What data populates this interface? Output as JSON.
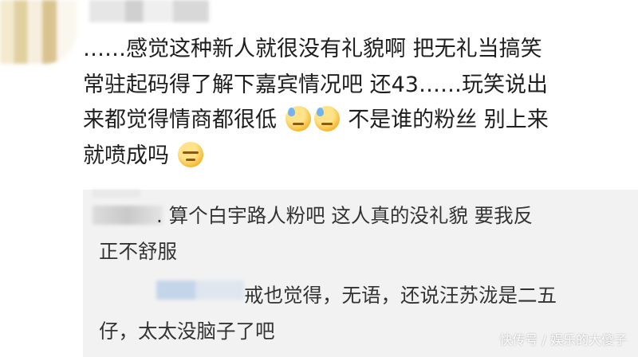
{
  "comment": {
    "line1": "……感觉这种新人就很没有礼貌啊 把无礼当搞笑",
    "line2": "常驻起码得了解下嘉宾情况吧 还43……玩笑说出",
    "line3_a": "来都觉得情商都很低",
    "line3_b": "不是谁的粉丝 别上来",
    "line4": "就喷成吗"
  },
  "emojis": {
    "sweat_1": "sweat-face-icon",
    "sweat_2": "sweat-face-icon",
    "smirk": "smirk-face-icon"
  },
  "replies": [
    {
      "line1": ". 算个白宇路人粉吧 这人真的没礼貌 要我反",
      "line2": "正不舒服"
    },
    {
      "line1": "戒也觉得，无语，还说汪苏泷是二五",
      "line2": "仔，太太没脑子了吧"
    }
  ],
  "watermark": "快传号 / 娱乐的大傻子"
}
